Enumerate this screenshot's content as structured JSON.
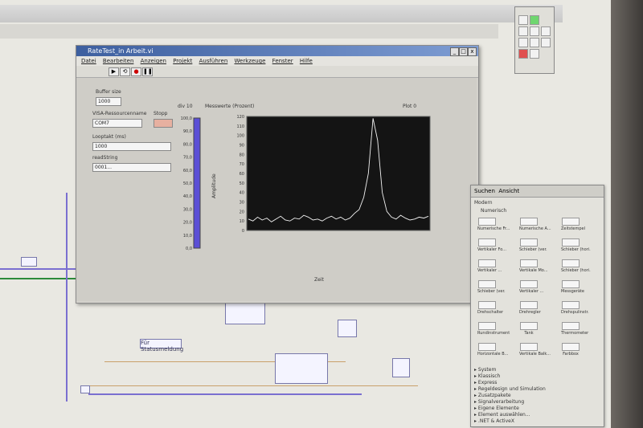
{
  "window": {
    "title": "RateTest_in Arbeit.vi"
  },
  "menu": [
    "Datei",
    "Bearbeiten",
    "Anzeigen",
    "Projekt",
    "Ausführen",
    "Werkzeuge",
    "Fenster",
    "Hilfe"
  ],
  "toolbar": {
    "run": "▶",
    "run_cont": "⟲",
    "abort": "●",
    "pause": "❚❚"
  },
  "controls": {
    "buffer_label": "Buffer size",
    "buffer_value": "1000",
    "visa_label": "VISA-Ressourcenname",
    "visa_value": "COM7",
    "stop_label": "Stopp",
    "loop_label": "Looptakt (ms)",
    "loop_value": "1000",
    "read_label": "readString",
    "read_value": "0001...",
    "tank_label": "div 10"
  },
  "graph": {
    "title": "Messwerte (Prozent)",
    "xlabel": "Zeit",
    "ylabel": "Amplitude",
    "legend": "Plot 0"
  },
  "chart_data": {
    "type": "line",
    "ylim": [
      0,
      120
    ],
    "yticks": [
      "120",
      "110",
      "100",
      "90",
      "80",
      "70",
      "60",
      "50",
      "40",
      "30",
      "20",
      "10",
      "0"
    ],
    "tank_ticks": [
      "100,0",
      "90,0",
      "80,0",
      "70,0",
      "60,0",
      "50,0",
      "40,0",
      "30,0",
      "20,0",
      "10,0",
      "0,0"
    ],
    "series": [
      {
        "values": [
          12,
          10,
          14,
          11,
          13,
          9,
          12,
          15,
          11,
          10,
          13,
          12,
          16,
          14,
          11,
          12,
          10,
          13,
          15,
          12,
          14,
          11,
          13,
          18,
          22,
          35,
          60,
          118,
          95,
          40,
          20,
          14,
          12,
          16,
          13,
          11,
          12,
          14,
          13,
          15
        ]
      }
    ]
  },
  "palette": {
    "tabs": [
      "Suchen",
      "Ansicht"
    ],
    "section": "Modern",
    "subsection": "Numerisch",
    "items": [
      "Numerische Fr...",
      "Numerische A...",
      "Zeitstempel",
      "Vertikaler Fo...",
      "Schieber (ver.",
      "Schieber (hori.",
      "Vertikaler ...",
      "Vertikale Mo...",
      "Schieber (hori.",
      "Schieber (ver.",
      "Vertikaler ...",
      "Messgeräte",
      "Drehschalter",
      "Drehregler",
      "Drehspulinstr.",
      "Rundinstrument",
      "Tank",
      "Thermometer",
      "Horizontale B...",
      "Vertikale Balk...",
      "Farbbox"
    ],
    "categories": [
      "System",
      "Klassisch",
      "Express",
      "Regeldesign und Simulation",
      "Zusatzpakete",
      "Signalverarbeitung",
      "Eigene Elemente",
      "Element auswählen...",
      ".NET & ActiveX"
    ]
  },
  "diagram": {
    "node_label": "Für Statusmeldung"
  }
}
